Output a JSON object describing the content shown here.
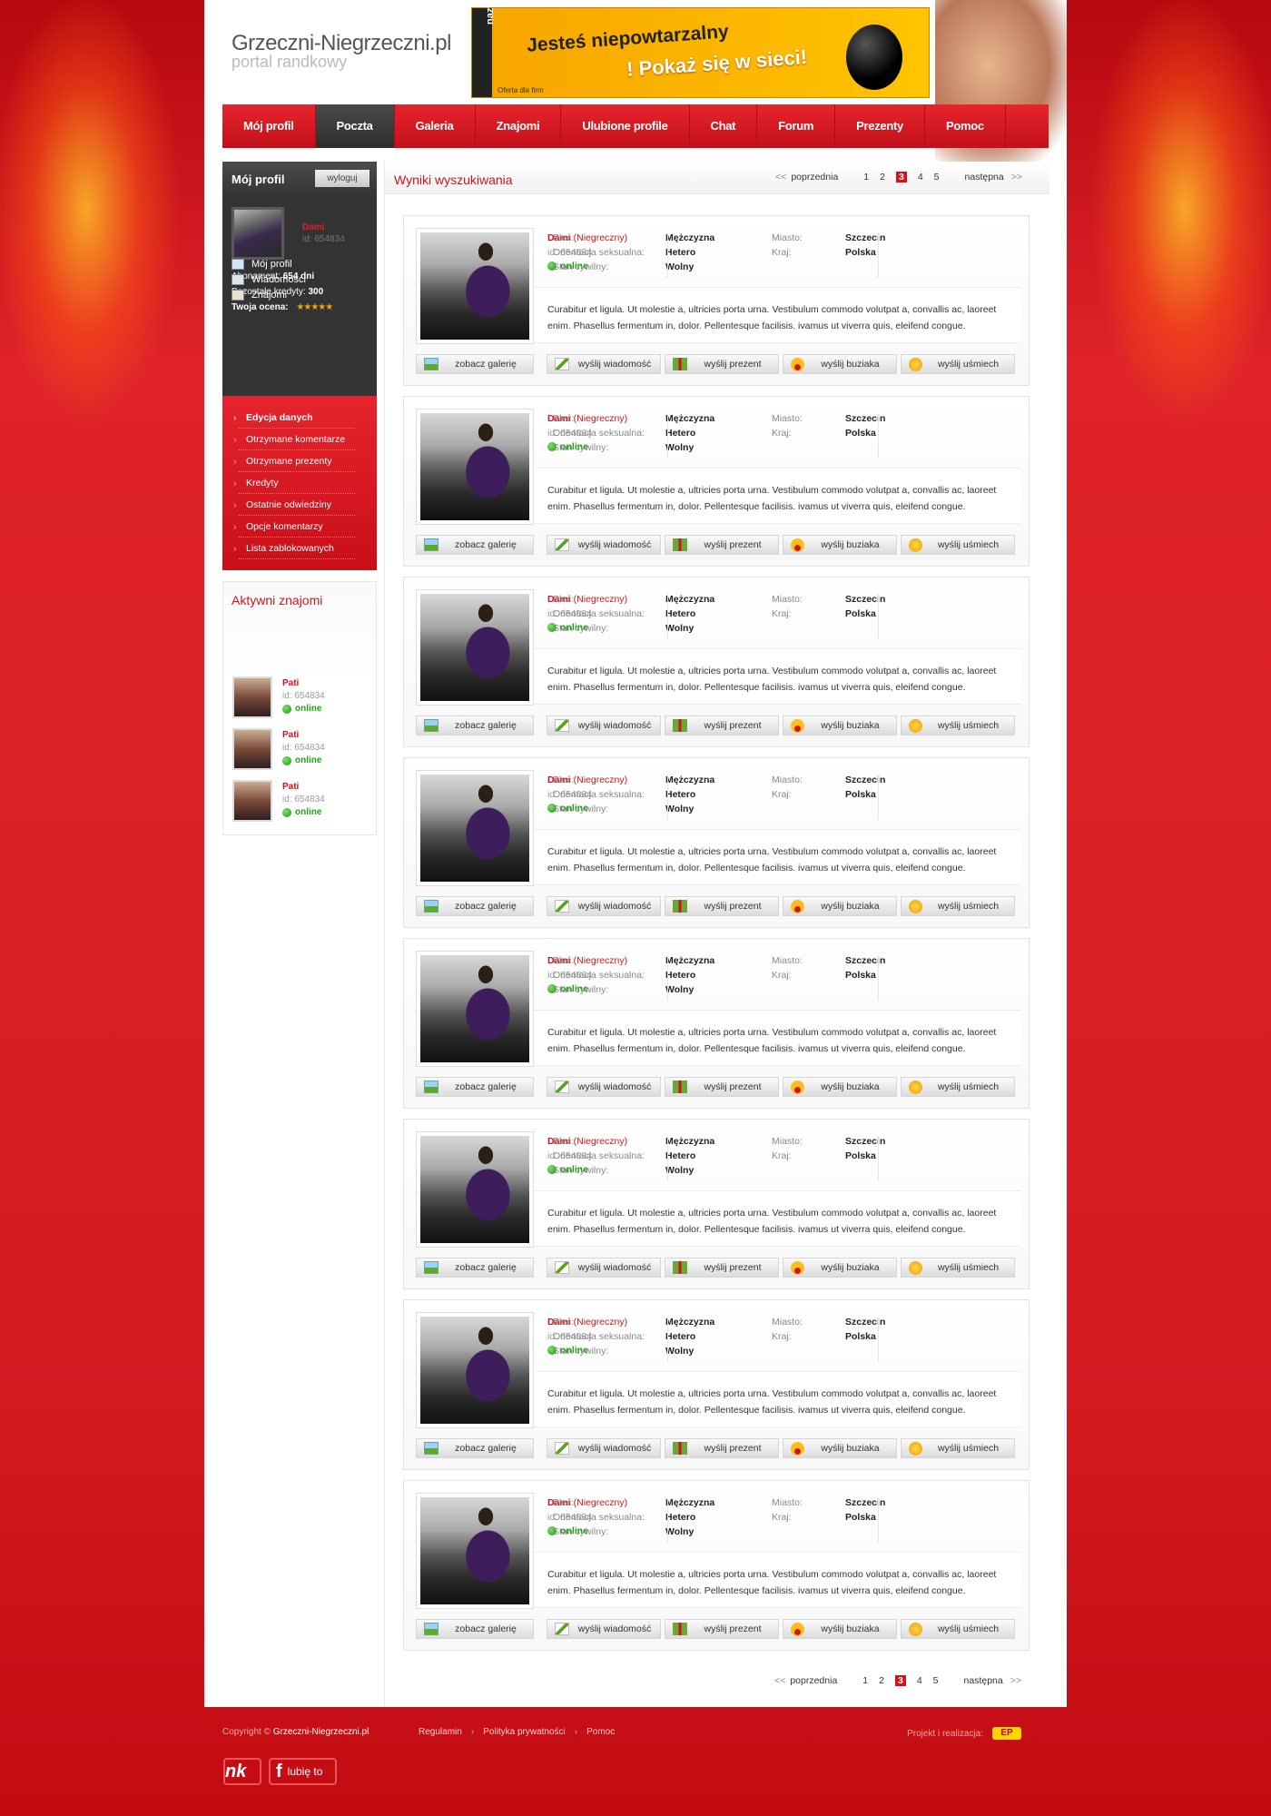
{
  "header": {
    "logo_title": "Grzeczni-Niegrzeczni.pl",
    "logo_subtitle": "portal randkowy",
    "banner_brand": "nazwa.pl",
    "banner_line1": "Jesteś niepowtarzalny",
    "banner_line2": "! Pokaż się w sieci!",
    "banner_small": "Oferta dla firm"
  },
  "nav": [
    {
      "label": "Mój profil"
    },
    {
      "label": "Poczta",
      "active": true
    },
    {
      "label": "Galeria"
    },
    {
      "label": "Znajomi"
    },
    {
      "label": "Ulubione profile"
    },
    {
      "label": "Chat"
    },
    {
      "label": "Forum"
    },
    {
      "label": "Prezenty"
    },
    {
      "label": "Pomoc"
    }
  ],
  "sidebar": {
    "profile_title": "Mój profil",
    "logout_label": "wyloguj",
    "me_name": "Dami",
    "me_id": "id: 654834",
    "abonament_label": "Abonament:",
    "abonament_value": "654 dni",
    "credits_label": "Pozostałe kredyty:",
    "credits_value": "300",
    "rating_label": "Twoja ocena:",
    "rating_stars": "★★★★★",
    "links": [
      {
        "label": "Mój profil",
        "icon": "profile-icon"
      },
      {
        "label": "Wiadomości",
        "icon": "mail-icon"
      },
      {
        "label": "Znajomi",
        "icon": "friends-icon"
      }
    ],
    "menu": [
      {
        "label": "Edycja danych",
        "bold": true
      },
      {
        "label": "Otrzymane komentarze"
      },
      {
        "label": "Otrzymane prezenty"
      },
      {
        "label": "Kredyty"
      },
      {
        "label": "Ostatnie odwiedziny"
      },
      {
        "label": "Opcje komentarzy"
      },
      {
        "label": "Lista zablokowanych"
      }
    ],
    "friends_title": "Aktywni znajomi",
    "friends": [
      {
        "name": "Pati",
        "id": "id: 654834",
        "status": "online"
      },
      {
        "name": "Pati",
        "id": "id: 654834",
        "status": "online"
      },
      {
        "name": "Pati",
        "id": "id: 654834",
        "status": "online"
      }
    ]
  },
  "results": {
    "title": "Wyniki wyszukiwania",
    "pager": {
      "prev": "poprzednia",
      "next": "następna",
      "prev_arrow": "<<",
      "next_arrow": ">>",
      "pages": [
        "1",
        "2",
        "3",
        "4",
        "5"
      ],
      "current": "3"
    },
    "labels": {
      "gender": "Płeć:",
      "orientation": "Orientacja seksualna:",
      "civil": "Stan cywilny:",
      "city": "Miasto:",
      "country": "Kraj:",
      "online": "online"
    },
    "buttons": {
      "gallery": "zobacz galerię",
      "message": "wyślij wiadomość",
      "gift": "wyślij prezent",
      "kiss": "wyślij buziaka",
      "smile": "wyślij uśmiech"
    },
    "cards": [
      {
        "name": "Dami",
        "type": "(Niegreczny)",
        "id": "id: 654834",
        "gender": "Mężczyzna",
        "orientation": "Hetero",
        "civil": "Wolny",
        "city": "Szczecin",
        "country": "Polska",
        "desc1": "Curabitur et ligula. Ut molestie a, ultricies porta urna. Vestibulum commodo volutpat a, convallis ac, laoreet",
        "desc2": "enim. Phasellus fermentum in, dolor. Pellentesque facilisis. ivamus ut viverra quis, eleifend congue."
      },
      {
        "name": "Dami",
        "type": "(Niegreczny)",
        "id": "id: 654834",
        "gender": "Mężczyzna",
        "orientation": "Hetero",
        "civil": "Wolny",
        "city": "Szczecin",
        "country": "Polska",
        "desc1": "Curabitur et ligula. Ut molestie a, ultricies porta urna. Vestibulum commodo volutpat a, convallis ac, laoreet",
        "desc2": "enim. Phasellus fermentum in, dolor. Pellentesque facilisis. ivamus ut viverra quis, eleifend congue."
      },
      {
        "name": "Dami",
        "type": "(Niegreczny)",
        "id": "id: 654834",
        "gender": "Mężczyzna",
        "orientation": "Hetero",
        "civil": "Wolny",
        "city": "Szczecin",
        "country": "Polska",
        "desc1": "Curabitur et ligula. Ut molestie a, ultricies porta urna. Vestibulum commodo volutpat a, convallis ac, laoreet",
        "desc2": "enim. Phasellus fermentum in, dolor. Pellentesque facilisis. ivamus ut viverra quis, eleifend congue."
      },
      {
        "name": "Dami",
        "type": "(Niegreczny)",
        "id": "id: 654834",
        "gender": "Mężczyzna",
        "orientation": "Hetero",
        "civil": "Wolny",
        "city": "Szczecin",
        "country": "Polska",
        "desc1": "Curabitur et ligula. Ut molestie a, ultricies porta urna. Vestibulum commodo volutpat a, convallis ac, laoreet",
        "desc2": "enim. Phasellus fermentum in, dolor. Pellentesque facilisis. ivamus ut viverra quis, eleifend congue."
      },
      {
        "name": "Dami",
        "type": "(Niegreczny)",
        "id": "id: 654834",
        "gender": "Mężczyzna",
        "orientation": "Hetero",
        "civil": "Wolny",
        "city": "Szczecin",
        "country": "Polska",
        "desc1": "Curabitur et ligula. Ut molestie a, ultricies porta urna. Vestibulum commodo volutpat a, convallis ac, laoreet",
        "desc2": "enim. Phasellus fermentum in, dolor. Pellentesque facilisis. ivamus ut viverra quis, eleifend congue."
      },
      {
        "name": "Dami",
        "type": "(Niegreczny)",
        "id": "id: 654834",
        "gender": "Mężczyzna",
        "orientation": "Hetero",
        "civil": "Wolny",
        "city": "Szczecin",
        "country": "Polska",
        "desc1": "Curabitur et ligula. Ut molestie a, ultricies porta urna. Vestibulum commodo volutpat a, convallis ac, laoreet",
        "desc2": "enim. Phasellus fermentum in, dolor. Pellentesque facilisis. ivamus ut viverra quis, eleifend congue."
      },
      {
        "name": "Dami",
        "type": "(Niegreczny)",
        "id": "id: 654834",
        "gender": "Mężczyzna",
        "orientation": "Hetero",
        "civil": "Wolny",
        "city": "Szczecin",
        "country": "Polska",
        "desc1": "Curabitur et ligula. Ut molestie a, ultricies porta urna. Vestibulum commodo volutpat a, convallis ac, laoreet",
        "desc2": "enim. Phasellus fermentum in, dolor. Pellentesque facilisis. ivamus ut viverra quis, eleifend congue."
      },
      {
        "name": "Dami",
        "type": "(Niegreczny)",
        "id": "id: 654834",
        "gender": "Mężczyzna",
        "orientation": "Hetero",
        "civil": "Wolny",
        "city": "Szczecin",
        "country": "Polska",
        "desc1": "Curabitur et ligula. Ut molestie a, ultricies porta urna. Vestibulum commodo volutpat a, convallis ac, laoreet",
        "desc2": "enim. Phasellus fermentum in, dolor. Pellentesque facilisis. ivamus ut viverra quis, eleifend congue."
      }
    ]
  },
  "footer": {
    "copyright": "Copyright ©",
    "site": "Grzeczni-Niegrzeczni.pl",
    "links": [
      "Regulamin",
      "Polityka prywatności",
      "Pomoc"
    ],
    "link_sep": "›",
    "credit_label": "Projekt i realizacja:",
    "credit_logo": "EP",
    "nk_label": "nk",
    "fb_icon_label": "f",
    "fb_label": "lubię to"
  },
  "colors": {
    "accent": "#d0141b",
    "online": "#1fa312",
    "dark": "#333333"
  }
}
